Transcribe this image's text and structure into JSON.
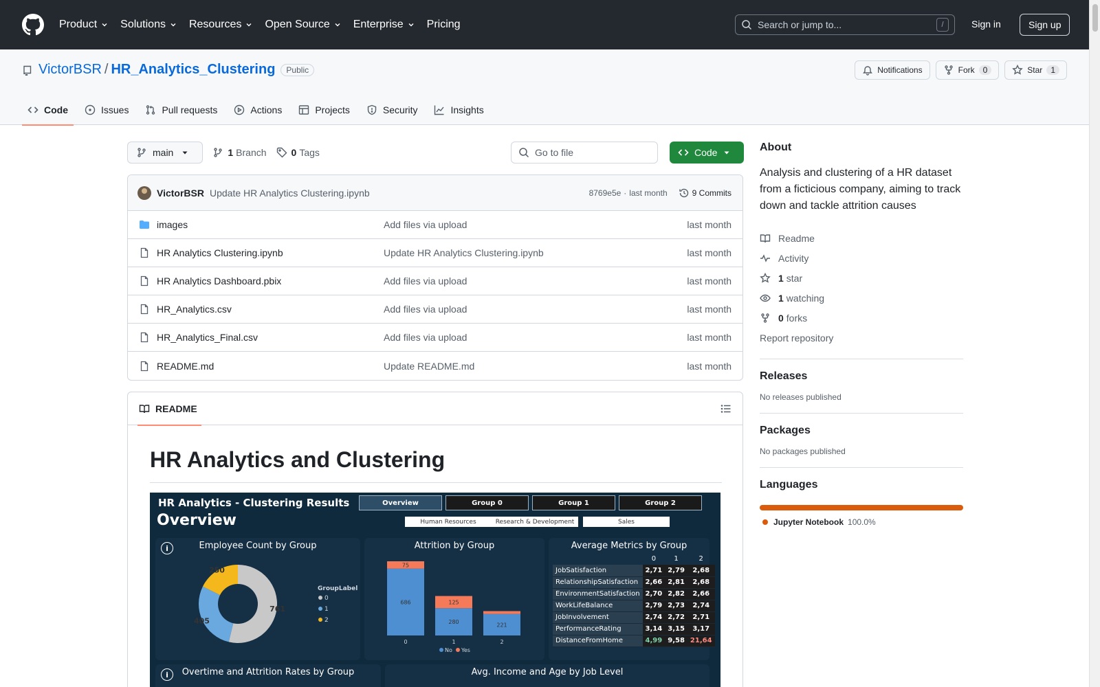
{
  "topnav": {
    "items": [
      {
        "label": "Product",
        "chevron": true
      },
      {
        "label": "Solutions",
        "chevron": true
      },
      {
        "label": "Resources",
        "chevron": true
      },
      {
        "label": "Open Source",
        "chevron": true
      },
      {
        "label": "Enterprise",
        "chevron": true
      },
      {
        "label": "Pricing",
        "chevron": false
      }
    ],
    "search_placeholder": "Search or jump to...",
    "search_shortcut": "/",
    "signin": "Sign in",
    "signup": "Sign up"
  },
  "repo": {
    "owner": "VictorBSR",
    "slash": "/",
    "name": "HR_Analytics_Clustering",
    "visibility": "Public",
    "notifications_label": "Notifications",
    "fork_label": "Fork",
    "fork_count": "0",
    "star_label": "Star",
    "star_count": "1"
  },
  "tabs": [
    {
      "label": "Code",
      "icon": "code-icon",
      "active": true
    },
    {
      "label": "Issues",
      "icon": "issue-icon"
    },
    {
      "label": "Pull requests",
      "icon": "pull-request-icon"
    },
    {
      "label": "Actions",
      "icon": "play-icon"
    },
    {
      "label": "Projects",
      "icon": "table-icon"
    },
    {
      "label": "Security",
      "icon": "shield-icon"
    },
    {
      "label": "Insights",
      "icon": "graph-icon"
    }
  ],
  "file_nav": {
    "branch": "main",
    "branch_count": "1",
    "branch_label": "Branch",
    "tag_count": "0",
    "tag_label": "Tags",
    "goto_placeholder": "Go to file",
    "code_button": "Code"
  },
  "commit": {
    "author": "VictorBSR",
    "message": "Update HR Analytics Clustering.ipynb",
    "hash": "8769e5e",
    "separator": "·",
    "time": "last month",
    "commits_count": "9 Commits"
  },
  "files": [
    {
      "name": "images",
      "type": "folder",
      "commit": "Add files via upload",
      "date": "last month"
    },
    {
      "name": "HR Analytics Clustering.ipynb",
      "type": "file",
      "commit": "Update HR Analytics Clustering.ipynb",
      "date": "last month"
    },
    {
      "name": "HR Analytics Dashboard.pbix",
      "type": "file",
      "commit": "Add files via upload",
      "date": "last month"
    },
    {
      "name": "HR_Analytics.csv",
      "type": "file",
      "commit": "Add files via upload",
      "date": "last month"
    },
    {
      "name": "HR_Analytics_Final.csv",
      "type": "file",
      "commit": "Add files via upload",
      "date": "last month"
    },
    {
      "name": "README.md",
      "type": "file",
      "commit": "Update README.md",
      "date": "last month"
    }
  ],
  "readme": {
    "tab_label": "README",
    "title": "HR Analytics and Clustering"
  },
  "dashboard": {
    "title": "HR Analytics - Clustering Results",
    "subtitle": "Overview",
    "tabs": [
      "Overview",
      "Group 0",
      "Group 1",
      "Group 2"
    ],
    "filters": [
      "Human Resources",
      "Research & Development",
      "Sales"
    ],
    "info_glyph": "i",
    "panel_employee_title": "Employee Count by Group",
    "panel_attrition_title": "Attrition by Group",
    "panel_metrics_title": "Average Metrics by Group",
    "panel_overtime_title": "Overtime and Attrition Rates by Group",
    "panel_income_title": "Avg. Income and Age by Job Level",
    "legend_title": "GroupLabel",
    "metrics_columns": [
      "0",
      "1",
      "2"
    ],
    "metrics_rows": [
      {
        "label": "JobSatisfaction",
        "values": [
          "2,71",
          "2,79",
          "2,68"
        ]
      },
      {
        "label": "RelationshipSatisfaction",
        "values": [
          "2,66",
          "2,81",
          "2,68"
        ]
      },
      {
        "label": "EnvironmentSatisfaction",
        "values": [
          "2,70",
          "2,82",
          "2,66"
        ]
      },
      {
        "label": "WorkLifeBalance",
        "values": [
          "2,79",
          "2,73",
          "2,74"
        ]
      },
      {
        "label": "JobInvolvement",
        "values": [
          "2,74",
          "2,72",
          "2,71"
        ]
      },
      {
        "label": "PerformanceRating",
        "values": [
          "3,14",
          "3,15",
          "3,17"
        ]
      },
      {
        "label": "DistanceFromHome",
        "values": [
          "4,99",
          "9,58",
          "21,64"
        ]
      }
    ],
    "distance_colors": [
      "#7fd1a8",
      "#ffffff",
      "#ff8a80"
    ]
  },
  "chart_data": [
    {
      "type": "pie",
      "title": "Employee Count by Group",
      "legend_title": "GroupLabel",
      "categories": [
        "0",
        "1",
        "2"
      ],
      "values": [
        761,
        405,
        250
      ],
      "colors": [
        "#c8c8c8",
        "#6aa9e0",
        "#f5b81c"
      ],
      "legend": "right"
    },
    {
      "type": "bar",
      "title": "Attrition by Group",
      "stacked": true,
      "categories": [
        "0",
        "1",
        "2"
      ],
      "series": [
        {
          "name": "No",
          "values": [
            686,
            280,
            221
          ],
          "color": "#4d8fd1"
        },
        {
          "name": "Yes",
          "values": [
            75,
            125,
            29
          ],
          "color": "#f47a5a"
        }
      ],
      "legend": "bottom"
    }
  ],
  "about": {
    "heading": "About",
    "description": "Analysis and clustering of a HR dataset from a ficticious company, aiming to track down and tackle attrition causes",
    "readme": "Readme",
    "activity": "Activity",
    "stars_count": "1",
    "stars_label": "star",
    "watching_count": "1",
    "watching_label": "watching",
    "forks_count": "0",
    "forks_label": "forks",
    "report": "Report repository"
  },
  "releases": {
    "heading": "Releases",
    "note": "No releases published"
  },
  "packages": {
    "heading": "Packages",
    "note": "No packages published"
  },
  "languages": {
    "heading": "Languages",
    "items": [
      {
        "name": "Jupyter Notebook",
        "percent": "100.0%",
        "color": "#DA5B0B"
      }
    ]
  }
}
